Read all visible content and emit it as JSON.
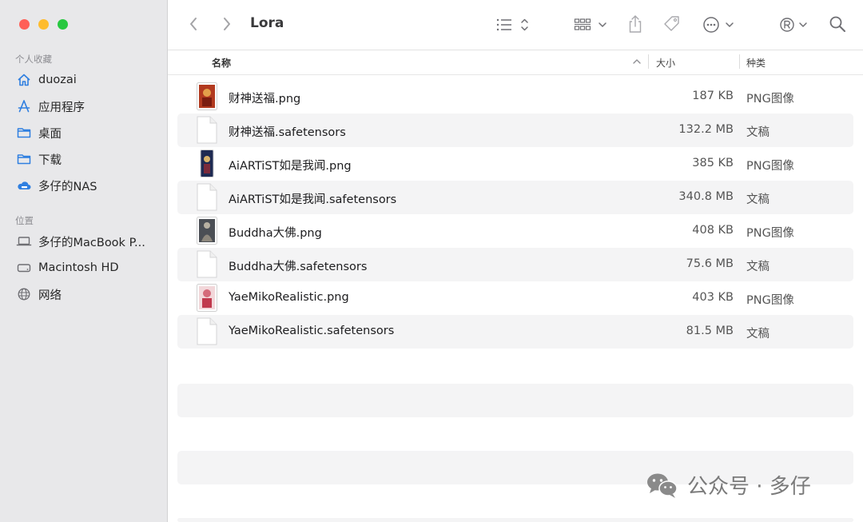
{
  "window": {
    "title": "Lora"
  },
  "sidebar": {
    "favorites_title": "个人收藏",
    "favorites": [
      {
        "label": "duozai",
        "icon": "house-icon"
      },
      {
        "label": "应用程序",
        "icon": "applications-icon"
      },
      {
        "label": "桌面",
        "icon": "folder-icon"
      },
      {
        "label": "下载",
        "icon": "folder-icon"
      },
      {
        "label": "多仔的NAS",
        "icon": "cloud-drive-icon"
      }
    ],
    "locations_title": "位置",
    "locations": [
      {
        "label": "多仔的MacBook P...",
        "icon": "laptop-icon"
      },
      {
        "label": "Macintosh HD",
        "icon": "disk-icon"
      },
      {
        "label": "网络",
        "icon": "globe-icon"
      }
    ]
  },
  "columns": {
    "name": "名称",
    "size": "大小",
    "kind": "种类"
  },
  "files": [
    {
      "name": "财神送福.png",
      "size": "187 KB",
      "kind": "PNG图像",
      "type": "image",
      "thumb_color": "#b23a1f"
    },
    {
      "name": "财神送福.safetensors",
      "size": "132.2 MB",
      "kind": "文稿",
      "type": "doc"
    },
    {
      "name": "AiARTiST如是我闻.png",
      "size": "385 KB",
      "kind": "PNG图像",
      "type": "image",
      "thumb_color": "#1e2a52"
    },
    {
      "name": "AiARTiST如是我闻.safetensors",
      "size": "340.8 MB",
      "kind": "文稿",
      "type": "doc"
    },
    {
      "name": "Buddha大佛.png",
      "size": "408 KB",
      "kind": "PNG图像",
      "type": "image",
      "thumb_color": "#4b4f55"
    },
    {
      "name": "Buddha大佛.safetensors",
      "size": "75.6 MB",
      "kind": "文稿",
      "type": "doc"
    },
    {
      "name": "YaeMikoRealistic.png",
      "size": "403 KB",
      "kind": "PNG图像",
      "type": "image",
      "thumb_color": "#d56a7a"
    },
    {
      "name": "YaeMikoRealistic.safetensors",
      "size": "81.5 MB",
      "kind": "文稿",
      "type": "doc"
    }
  ],
  "watermark": {
    "text": "公众号 · 多仔"
  }
}
